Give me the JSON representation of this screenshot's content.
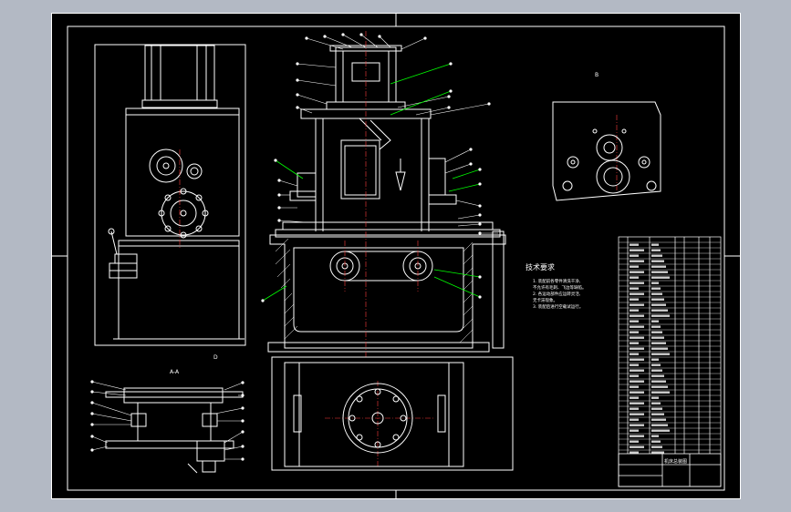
{
  "colors": {
    "background_outer": "#b3b9c4",
    "canvas": "#000000",
    "lines": "#ffffff",
    "leaders": "#00ff00",
    "centerlines": "#ff3b3b"
  },
  "view_labels": {
    "section_aa": "A-A",
    "detail_top_right": "B",
    "left_view_mark": "D"
  },
  "notes": {
    "heading": "技术要求",
    "lines": [
      "1. 装配前各零件清洗干净,",
      "   不允许有毛刺、飞边等缺陷。",
      "2. 各运动部件应运转灵活,",
      "   无卡滞现象。",
      "3. 装配后进行空载试运行。"
    ]
  },
  "title_block": {
    "drawing_name": "机床总装图"
  },
  "balloon_count_note": "balloons drawn without legible numbers"
}
